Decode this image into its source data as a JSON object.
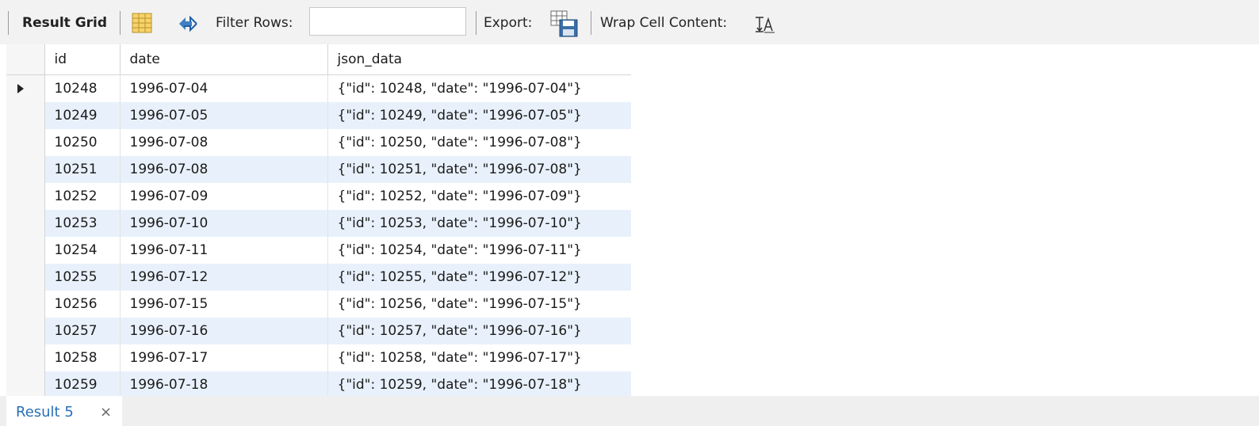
{
  "toolbar": {
    "result_grid_label": "Result Grid",
    "filter_rows_label": "Filter Rows:",
    "filter_value": "",
    "export_label": "Export:",
    "wrap_label": "Wrap Cell Content:",
    "icons": [
      "grid-layout-icon",
      "refresh-icon",
      "export-save-icon",
      "wrap-cell-icon"
    ]
  },
  "grid": {
    "columns": [
      "id",
      "date",
      "json_data"
    ],
    "current_row_index": 0,
    "rows": [
      {
        "id": "10248",
        "date": "1996-07-04",
        "json_data": "{\"id\": 10248, \"date\": \"1996-07-04\"}"
      },
      {
        "id": "10249",
        "date": "1996-07-05",
        "json_data": "{\"id\": 10249, \"date\": \"1996-07-05\"}"
      },
      {
        "id": "10250",
        "date": "1996-07-08",
        "json_data": "{\"id\": 10250, \"date\": \"1996-07-08\"}"
      },
      {
        "id": "10251",
        "date": "1996-07-08",
        "json_data": "{\"id\": 10251, \"date\": \"1996-07-08\"}"
      },
      {
        "id": "10252",
        "date": "1996-07-09",
        "json_data": "{\"id\": 10252, \"date\": \"1996-07-09\"}"
      },
      {
        "id": "10253",
        "date": "1996-07-10",
        "json_data": "{\"id\": 10253, \"date\": \"1996-07-10\"}"
      },
      {
        "id": "10254",
        "date": "1996-07-11",
        "json_data": "{\"id\": 10254, \"date\": \"1996-07-11\"}"
      },
      {
        "id": "10255",
        "date": "1996-07-12",
        "json_data": "{\"id\": 10255, \"date\": \"1996-07-12\"}"
      },
      {
        "id": "10256",
        "date": "1996-07-15",
        "json_data": "{\"id\": 10256, \"date\": \"1996-07-15\"}"
      },
      {
        "id": "10257",
        "date": "1996-07-16",
        "json_data": "{\"id\": 10257, \"date\": \"1996-07-16\"}"
      },
      {
        "id": "10258",
        "date": "1996-07-17",
        "json_data": "{\"id\": 10258, \"date\": \"1996-07-17\"}"
      },
      {
        "id": "10259",
        "date": "1996-07-18",
        "json_data": "{\"id\": 10259, \"date\": \"1996-07-18\"}"
      }
    ]
  },
  "tabs": {
    "result_tab_label": "Result 5",
    "close_glyph": "×"
  },
  "colors": {
    "alt_row": "#e8f1fb",
    "toolbar_bg": "#f2f2f2",
    "tab_label": "#2a6fb5"
  }
}
